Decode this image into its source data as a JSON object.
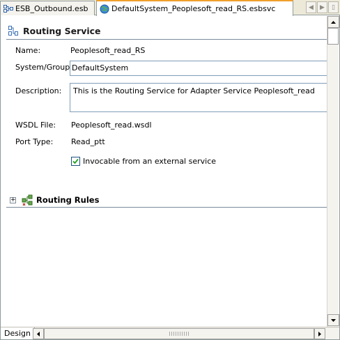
{
  "tabs": [
    {
      "label": "ESB_Outbound.esb",
      "icon": "esb-diagram-icon",
      "active": false
    },
    {
      "label": "DefaultSystem_Peoplesoft_read_RS.esbsvc",
      "icon": "globe-service-icon",
      "active": true
    }
  ],
  "tab_nav": {
    "left_icon": "scroll-left-icon",
    "right_icon": "scroll-right-icon",
    "list_icon": "tab-list-icon"
  },
  "section": {
    "title": "Routing Service",
    "icon": "routing-service-icon"
  },
  "fields": {
    "name_label": "Name:",
    "name_value": "Peoplesoft_read_RS",
    "system_label": "System/Group:",
    "system_value": "DefaultSystem",
    "description_label": "Description:",
    "description_value": "This is the Routing Service for Adapter Service Peoplesoft_read",
    "wsdl_label": "WSDL File:",
    "wsdl_value": "Peoplesoft_read.wsdl",
    "port_label": "Port Type:",
    "port_value": "Read_ptt"
  },
  "invocable": {
    "label": "Invocable from an external service",
    "checked": true
  },
  "routing_rules": {
    "label": "Routing Rules",
    "icon": "routing-rules-icon",
    "expanded": false
  },
  "bottom": {
    "design_tab": "Design"
  },
  "colors": {
    "tab_accent": "#f0a02c",
    "chrome": "#ece9d8",
    "border": "#919b9c"
  }
}
